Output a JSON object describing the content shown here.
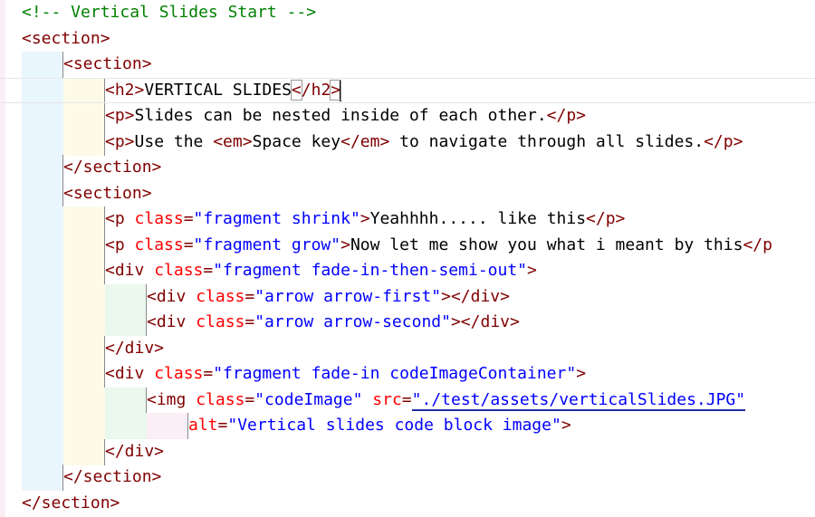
{
  "editor": {
    "lines": [
      {
        "indent": 0,
        "tokens": [
          {
            "c": "comment",
            "t": "<!-- Vertical Slides Start -->"
          }
        ]
      },
      {
        "indent": 0,
        "tokens": [
          {
            "c": "tag",
            "t": "<section>"
          }
        ]
      },
      {
        "indent": 1,
        "tokens": [
          {
            "c": "tag",
            "t": "<section>"
          }
        ]
      },
      {
        "indent": 2,
        "tokens": [
          {
            "c": "tag",
            "t": "<h2>"
          },
          {
            "c": "txt",
            "t": "VERTICAL SLIDES"
          },
          {
            "c": "tag bracket-match",
            "t": "<"
          },
          {
            "c": "tag",
            "t": "/h2"
          },
          {
            "c": "tag bracket-match",
            "t": ">"
          },
          {
            "c": "caret",
            "t": ""
          }
        ]
      },
      {
        "indent": 2,
        "tokens": [
          {
            "c": "tag",
            "t": "<p>"
          },
          {
            "c": "txt",
            "t": "Slides can be nested inside of each other."
          },
          {
            "c": "tag",
            "t": "</p>"
          }
        ]
      },
      {
        "indent": 2,
        "tokens": [
          {
            "c": "tag",
            "t": "<p>"
          },
          {
            "c": "txt",
            "t": "Use the "
          },
          {
            "c": "tag",
            "t": "<em>"
          },
          {
            "c": "txt",
            "t": "Space key"
          },
          {
            "c": "tag",
            "t": "</em>"
          },
          {
            "c": "txt",
            "t": " to navigate through all slides."
          },
          {
            "c": "tag",
            "t": "</p>"
          }
        ]
      },
      {
        "indent": 1,
        "tokens": [
          {
            "c": "tag",
            "t": "</section>"
          }
        ]
      },
      {
        "indent": 1,
        "tokens": [
          {
            "c": "tag",
            "t": "<section>"
          }
        ]
      },
      {
        "indent": 2,
        "tokens": [
          {
            "c": "tag",
            "t": "<p "
          },
          {
            "c": "attr",
            "t": "class"
          },
          {
            "c": "tag",
            "t": "="
          },
          {
            "c": "val",
            "t": "\"fragment shrink\""
          },
          {
            "c": "tag",
            "t": ">"
          },
          {
            "c": "txt",
            "t": "Yeahhhh..... like this"
          },
          {
            "c": "tag",
            "t": "</p>"
          }
        ]
      },
      {
        "indent": 2,
        "tokens": [
          {
            "c": "tag",
            "t": "<p "
          },
          {
            "c": "attr",
            "t": "class"
          },
          {
            "c": "tag",
            "t": "="
          },
          {
            "c": "val",
            "t": "\"fragment grow\""
          },
          {
            "c": "tag",
            "t": ">"
          },
          {
            "c": "txt",
            "t": "Now let me show you what i meant by this"
          },
          {
            "c": "tag",
            "t": "</p"
          }
        ]
      },
      {
        "indent": 2,
        "tokens": [
          {
            "c": "tag",
            "t": "<div "
          },
          {
            "c": "attr",
            "t": "class"
          },
          {
            "c": "tag",
            "t": "="
          },
          {
            "c": "val",
            "t": "\"fragment fade-in-then-semi-out\""
          },
          {
            "c": "tag",
            "t": ">"
          }
        ]
      },
      {
        "indent": 3,
        "tokens": [
          {
            "c": "tag",
            "t": "<div "
          },
          {
            "c": "attr",
            "t": "class"
          },
          {
            "c": "tag",
            "t": "="
          },
          {
            "c": "val",
            "t": "\"arrow arrow-first\""
          },
          {
            "c": "tag",
            "t": "></div>"
          }
        ]
      },
      {
        "indent": 3,
        "tokens": [
          {
            "c": "tag",
            "t": "<div "
          },
          {
            "c": "attr",
            "t": "class"
          },
          {
            "c": "tag",
            "t": "="
          },
          {
            "c": "val",
            "t": "\"arrow arrow-second\""
          },
          {
            "c": "tag",
            "t": "></div>"
          }
        ]
      },
      {
        "indent": 2,
        "tokens": [
          {
            "c": "tag",
            "t": "</div>"
          }
        ]
      },
      {
        "indent": 2,
        "tokens": [
          {
            "c": "tag",
            "t": "<div "
          },
          {
            "c": "attr",
            "t": "class"
          },
          {
            "c": "tag",
            "t": "="
          },
          {
            "c": "val",
            "t": "\"fragment fade-in codeImageContainer\""
          },
          {
            "c": "tag",
            "t": ">"
          }
        ]
      },
      {
        "indent": 3,
        "tokens": [
          {
            "c": "tag",
            "t": "<img "
          },
          {
            "c": "attr",
            "t": "class"
          },
          {
            "c": "tag",
            "t": "="
          },
          {
            "c": "val",
            "t": "\"codeImage\""
          },
          {
            "c": "tag",
            "t": " "
          },
          {
            "c": "attr",
            "t": "src"
          },
          {
            "c": "tag",
            "t": "="
          },
          {
            "c": "val link-underline",
            "t": "\"./test/assets/verticalSlides.JPG\""
          }
        ]
      },
      {
        "indent": 4,
        "tokens": [
          {
            "c": "attr",
            "t": "alt"
          },
          {
            "c": "tag",
            "t": "="
          },
          {
            "c": "val",
            "t": "\"Vertical slides code block image\""
          },
          {
            "c": "tag",
            "t": ">"
          }
        ]
      },
      {
        "indent": 2,
        "tokens": [
          {
            "c": "tag",
            "t": "</div>"
          }
        ]
      },
      {
        "indent": 1,
        "tokens": [
          {
            "c": "tag",
            "t": "</section>"
          }
        ]
      },
      {
        "indent": 0,
        "tokens": [
          {
            "c": "tag",
            "t": "</section>"
          }
        ]
      }
    ]
  },
  "colors": {
    "tag": "#800000",
    "attribute": "#ff0000",
    "value": "#0000ff",
    "text": "#000000",
    "comment": "#008000",
    "indent_guides": [
      "#eaf6fd",
      "#fdfbe8",
      "#eaf8ee",
      "#fbeef6"
    ]
  }
}
